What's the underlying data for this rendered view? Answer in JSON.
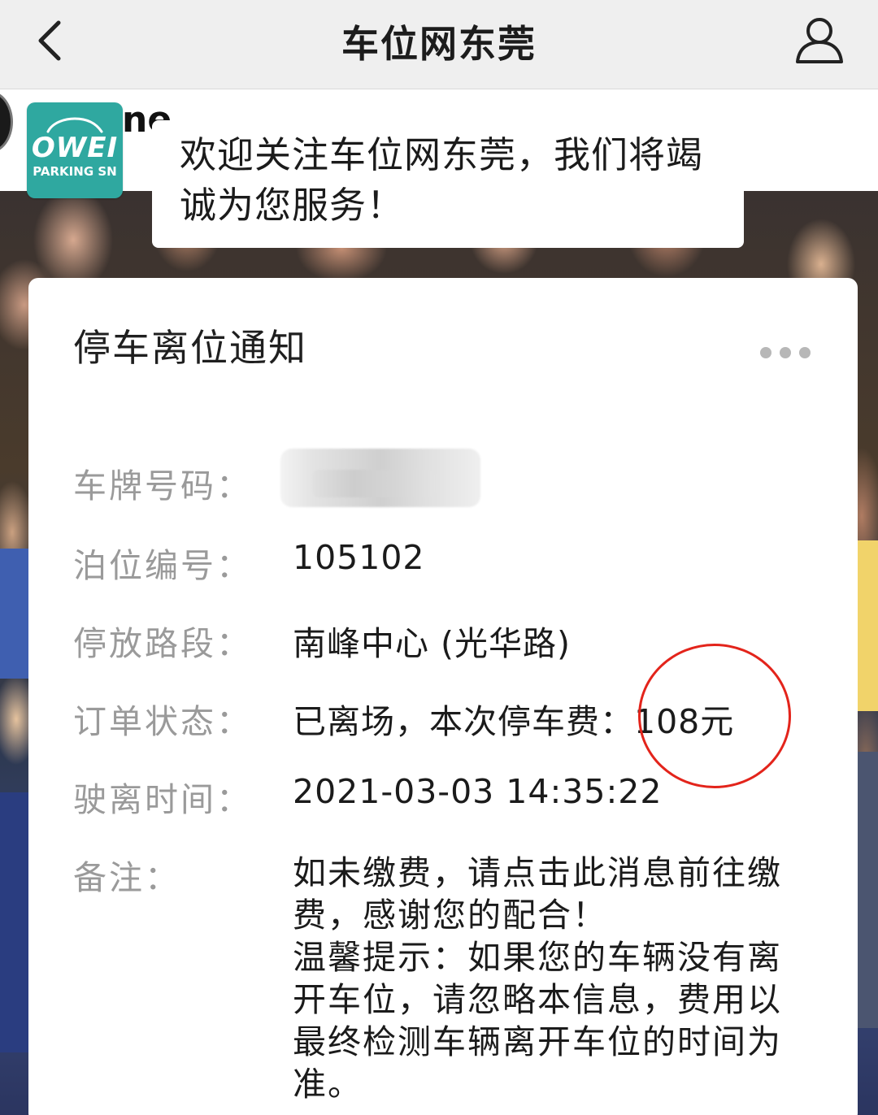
{
  "header": {
    "title": "车位网东莞",
    "back_icon": "chevron-left-icon",
    "user_icon": "user-icon"
  },
  "account": {
    "logo_text": "OWEI",
    "logo_subtext": "PARKING SN",
    "name_peek": "ne",
    "welcome": "欢迎关注车位网东莞，我们将竭诚为您服务！"
  },
  "card": {
    "title": "停车离位通知",
    "more_icon": "more-dots-icon",
    "rows": [
      {
        "label": "车牌号码：",
        "value": ""
      },
      {
        "label": "泊位编号：",
        "value": "105102"
      },
      {
        "label": "停放路段：",
        "value": "南峰中心 (光华路)"
      },
      {
        "label": "订单状态：",
        "value": "已离场，本次停车费：108元"
      },
      {
        "label": "驶离时间：",
        "value": "2021-03-03 14:35:22"
      },
      {
        "label": "备注：",
        "value": ""
      }
    ],
    "remark_lines": [
      "如未缴费，请点击此消息前往缴",
      "费，感谢您的配合！",
      "温馨提示：如果您的车辆没有离",
      "开车位，请忽略本信息，费用以",
      "最终检测车辆离开车位的时间为",
      "准。"
    ]
  },
  "colors": {
    "header_bg": "#efefef",
    "logo_teal": "#2fa8a0",
    "circle_red": "#e3241b",
    "label_gray": "#9a9a9a"
  }
}
